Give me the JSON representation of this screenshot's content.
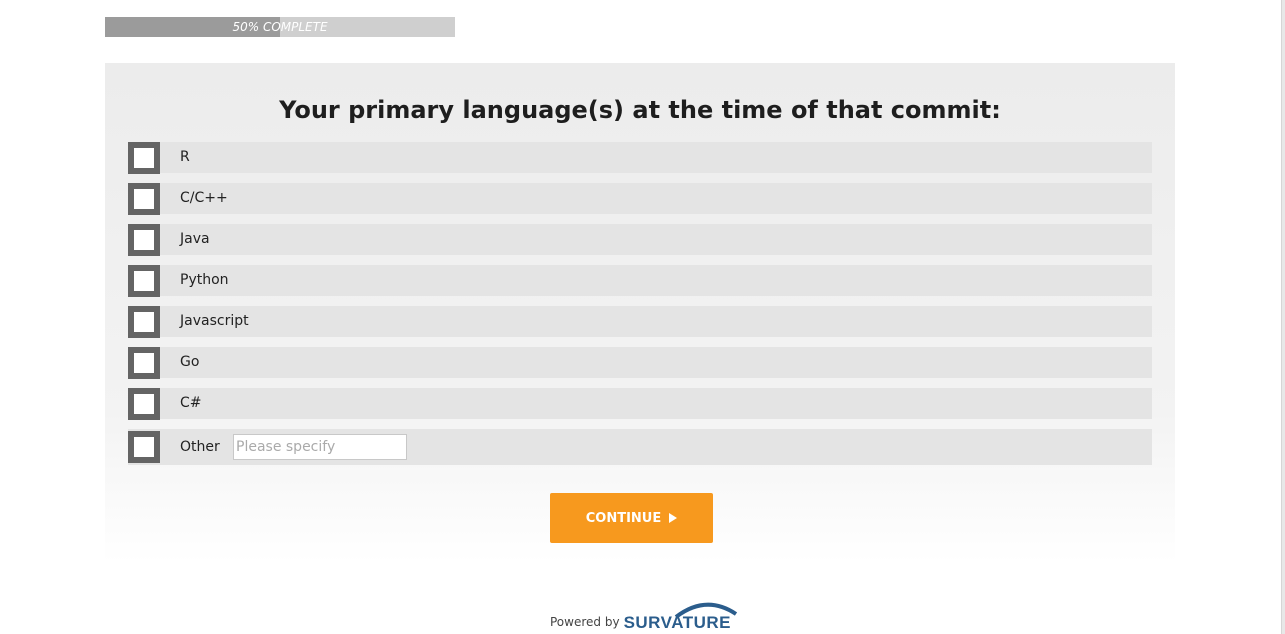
{
  "progress": {
    "label": "50% COMPLETE",
    "value": 0.5,
    "fill_color": "#9b9b9b",
    "track_color": "#cfcfcf"
  },
  "question": {
    "title": "Your primary language(s) at the time of that commit:"
  },
  "options": [
    {
      "label": "R",
      "checked": false
    },
    {
      "label": "C/C++",
      "checked": false
    },
    {
      "label": "Java",
      "checked": false
    },
    {
      "label": "Python",
      "checked": false
    },
    {
      "label": "Javascript",
      "checked": false
    },
    {
      "label": "Go",
      "checked": false
    },
    {
      "label": "C#",
      "checked": false
    }
  ],
  "other": {
    "label": "Other",
    "placeholder": "Please specify",
    "value": "",
    "checked": false
  },
  "continue_button": {
    "label": "CONTINUE",
    "color": "#f7991e",
    "icon": "play-icon"
  },
  "footer": {
    "powered_by": "Powered by",
    "logo_text": "SURVATURE",
    "logo_color": "#2b5d8c"
  }
}
